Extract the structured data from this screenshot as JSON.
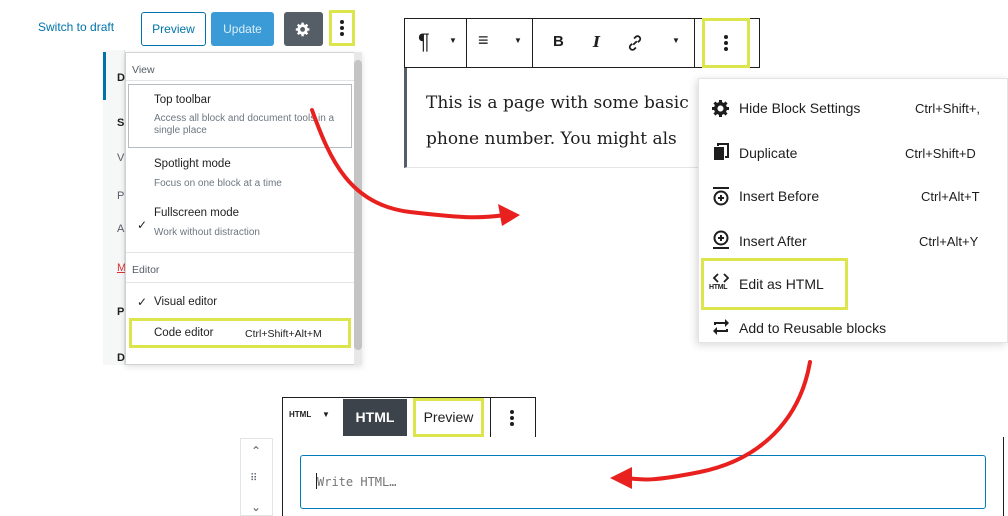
{
  "panel1": {
    "header": {
      "switch_to_draft": "Switch to draft",
      "preview": "Preview",
      "update": "Update"
    },
    "sidebar_letters": [
      "D",
      "S",
      "V",
      "P",
      "A",
      "M",
      "P",
      "D"
    ],
    "menu": {
      "view_label": "View",
      "items": [
        {
          "title": "Top toolbar",
          "desc": "Access all block and document tools in a single place",
          "checked": false
        },
        {
          "title": "Spotlight mode",
          "desc": "Focus on one block at a time",
          "checked": false
        },
        {
          "title": "Fullscreen mode",
          "desc": "Work without distraction",
          "checked": true
        }
      ],
      "editor_label": "Editor",
      "editor_items": [
        {
          "title": "Visual editor",
          "shortcut": "",
          "checked": true
        },
        {
          "title": "Code editor",
          "shortcut": "Ctrl+Shift+Alt+M",
          "checked": false
        }
      ]
    }
  },
  "panel2": {
    "content_lines": [
      "This is a page with some basic",
      "phone number. You might als"
    ],
    "menu": [
      {
        "label": "Hide Block Settings",
        "shortcut": "Ctrl+Shift+,",
        "icon": "gear-icon"
      },
      {
        "label": "Duplicate",
        "shortcut": "Ctrl+Shift+D",
        "icon": "duplicate-icon"
      },
      {
        "label": "Insert Before",
        "shortcut": "Ctrl+Alt+T",
        "icon": "insert-before-icon"
      },
      {
        "label": "Insert After",
        "shortcut": "Ctrl+Alt+Y",
        "icon": "insert-after-icon"
      },
      {
        "label": "Edit as HTML",
        "shortcut": "",
        "icon": "html-icon"
      },
      {
        "label": "Add to Reusable blocks",
        "shortcut": "",
        "icon": "reusable-icon"
      }
    ],
    "html_icon_text": "HTML"
  },
  "panel3": {
    "block_type": "HTML",
    "tab_html": "HTML",
    "tab_preview": "Preview",
    "placeholder": "Write HTML…"
  },
  "colors": {
    "highlight": "#dde54c",
    "arrow": "#e8211f",
    "wp_blue": "#0073aa"
  }
}
